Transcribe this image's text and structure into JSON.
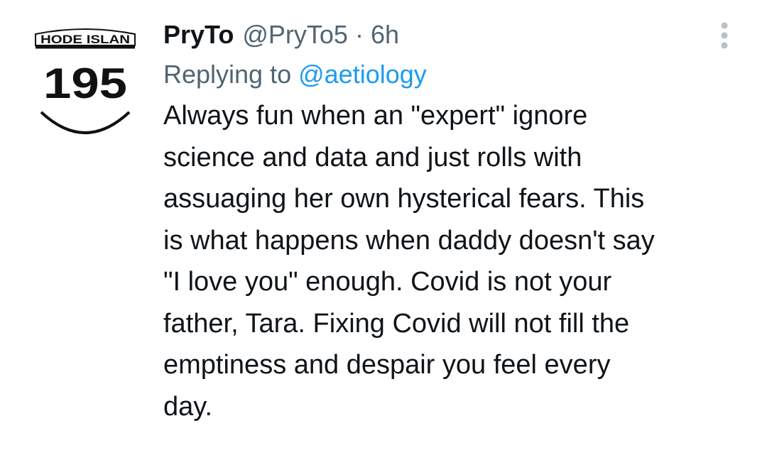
{
  "tweet": {
    "avatar": {
      "shield_text": "HODE ISLAN",
      "route_number": "195"
    },
    "author": {
      "display_name": "PryTo",
      "handle": "@PryTo5"
    },
    "separator": "·",
    "timestamp": "6h",
    "reply": {
      "prefix": "Replying to",
      "handle": "@aetiology"
    },
    "text_lines": [
      "Always fun when an \"expert\" ignore",
      "science and data and just rolls with",
      "assuaging her own hysterical fears. This",
      "is what happens when daddy doesn't say",
      "\"I love you\" enough. Covid is not your",
      "father, Tara. Fixing Covid will not fill the",
      "emptiness and despair you feel every",
      "day."
    ],
    "more_icon": "vertical-ellipsis-icon"
  },
  "colors": {
    "text_primary": "#0f1419",
    "text_secondary": "#536471",
    "link": "#1d9bf0",
    "background": "#ffffff"
  }
}
